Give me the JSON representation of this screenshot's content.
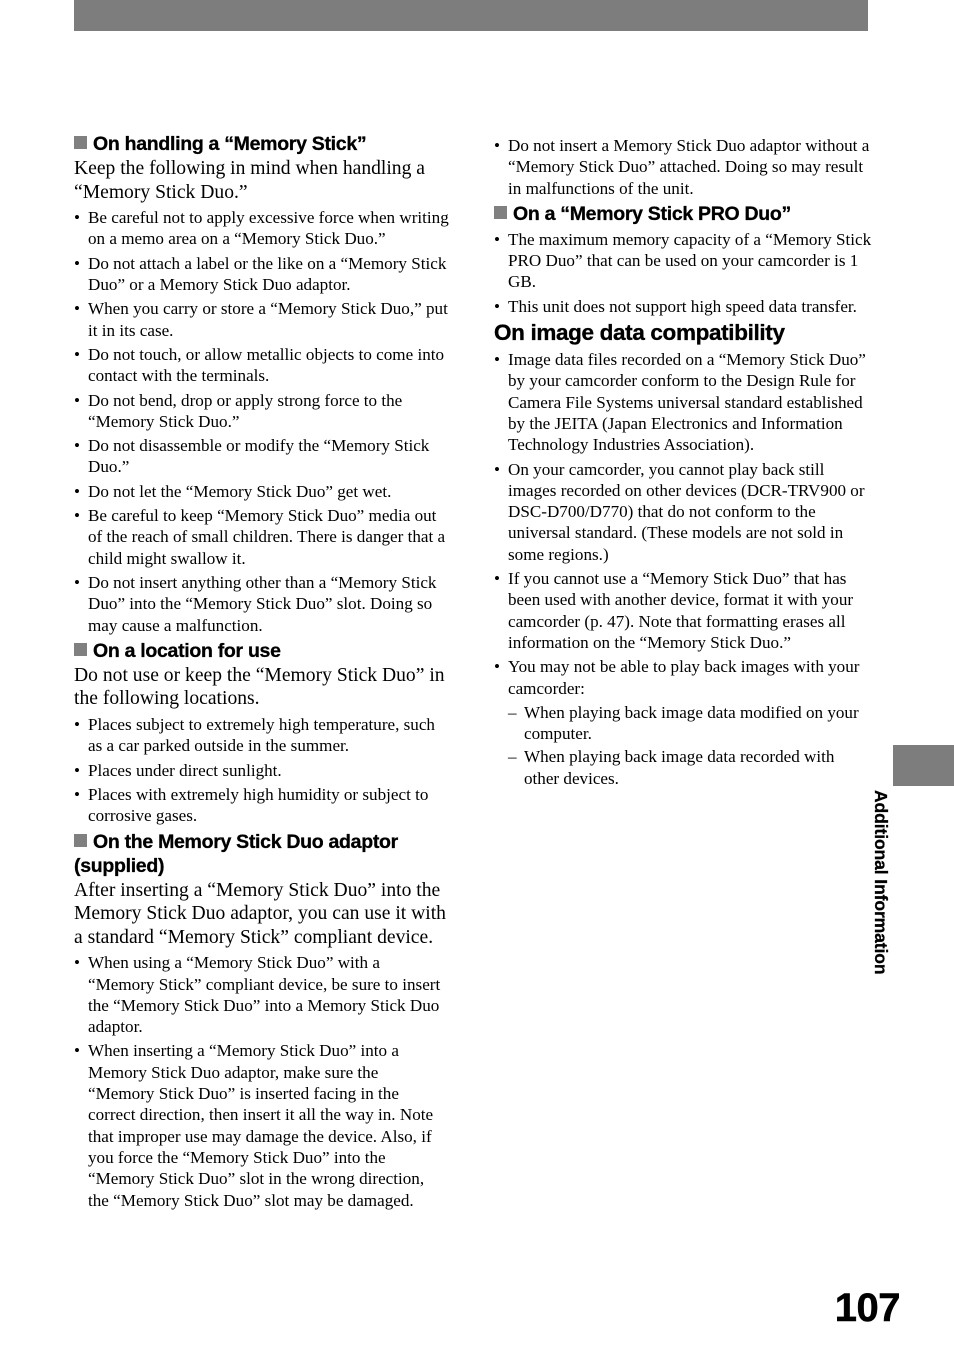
{
  "page": {
    "number": "107",
    "thumb_tab_label": "Additional Information",
    "header_bar_color": "#7d7d7d",
    "square_bullet_color": "#808080"
  },
  "left_column": {
    "blocks": [
      {
        "type": "subheading",
        "text": "On handling a “Memory Stick”"
      },
      {
        "type": "lead",
        "text": "Keep the following in mind when handling a “Memory Stick Duo.”"
      },
      {
        "type": "bullets",
        "items": [
          "Be careful not to apply excessive force when writing on a memo area on a “Memory Stick Duo.”",
          "Do not attach a label or the like on a “Memory Stick Duo” or a Memory Stick Duo adaptor.",
          "When you carry or store a “Memory Stick Duo,” put it in its case.",
          "Do not touch, or allow metallic objects to come into contact with the terminals.",
          "Do not bend, drop or apply strong force to the “Memory Stick Duo.”",
          "Do not disassemble or modify the “Memory Stick Duo.”",
          "Do not let the “Memory Stick Duo” get wet.",
          "Be careful to keep “Memory Stick Duo” media out of the reach of small children. There is danger that a child might swallow it.",
          "Do not insert anything other than a “Memory Stick Duo” into the “Memory Stick Duo” slot. Doing so may cause a malfunction."
        ]
      },
      {
        "type": "subheading",
        "text": "On a location for use"
      },
      {
        "type": "lead",
        "text": "Do not use or keep the “Memory Stick Duo” in the following locations."
      },
      {
        "type": "bullets",
        "items": [
          "Places subject to extremely high temperature, such as a car parked outside in the summer.",
          "Places under direct sunlight.",
          "Places with extremely high humidity or subject to corrosive gases."
        ]
      },
      {
        "type": "subheading",
        "text": "On the Memory Stick Duo adaptor (supplied)"
      },
      {
        "type": "lead",
        "text": "After inserting a “Memory Stick Duo” into the Memory Stick Duo adaptor, you can use it with a standard “Memory Stick” compliant device."
      },
      {
        "type": "bullets",
        "items": [
          "When using a “Memory Stick Duo” with a “Memory Stick” compliant device, be sure to insert the “Memory Stick Duo” into a Memory Stick Duo adaptor.",
          "When inserting a “Memory Stick Duo” into a Memory Stick Duo adaptor, make sure the “Memory Stick Duo” is inserted facing in the correct direction, then insert it all the way in. Note that improper use may damage the device. Also, if you force the “Memory Stick Duo” into the “Memory Stick Duo” slot in the wrong direction, the “Memory Stick Duo” slot may be damaged."
        ]
      }
    ]
  },
  "right_column": {
    "blocks": [
      {
        "type": "bullets",
        "items": [
          "Do not insert a Memory Stick Duo adaptor without a “Memory Stick Duo” attached. Doing so may result in malfunctions of the unit."
        ]
      },
      {
        "type": "subheading",
        "text": "On a “Memory Stick PRO Duo”"
      },
      {
        "type": "bullets",
        "items": [
          "The maximum memory capacity of a “Memory Stick PRO Duo” that can be used on your camcorder is 1 GB.",
          "This unit does not support high speed data transfer."
        ]
      },
      {
        "type": "section",
        "text": "On image data compatibility"
      },
      {
        "type": "bullets",
        "items": [
          "Image data files recorded on a “Memory Stick Duo” by your camcorder conform to the Design Rule for Camera File Systems universal standard established by the JEITA (Japan Electronics and Information Technology Industries Association).",
          "On your camcorder, you cannot play back still images recorded on other devices (DCR-TRV900 or DSC-D700/D770) that do not conform to the universal standard. (These models are not sold in some regions.)",
          "If you cannot use a “Memory Stick Duo” that has been used with another device, format it with your camcorder (p. 47). Note that formatting erases all information on the “Memory Stick Duo.”",
          "You may not be able to play back images with your camcorder:"
        ]
      },
      {
        "type": "dashes",
        "items": [
          "When playing back image data modified on your computer.",
          "When playing back image data recorded with other devices."
        ]
      }
    ]
  },
  "markers": {
    "bullet": "•",
    "dash": "–"
  }
}
